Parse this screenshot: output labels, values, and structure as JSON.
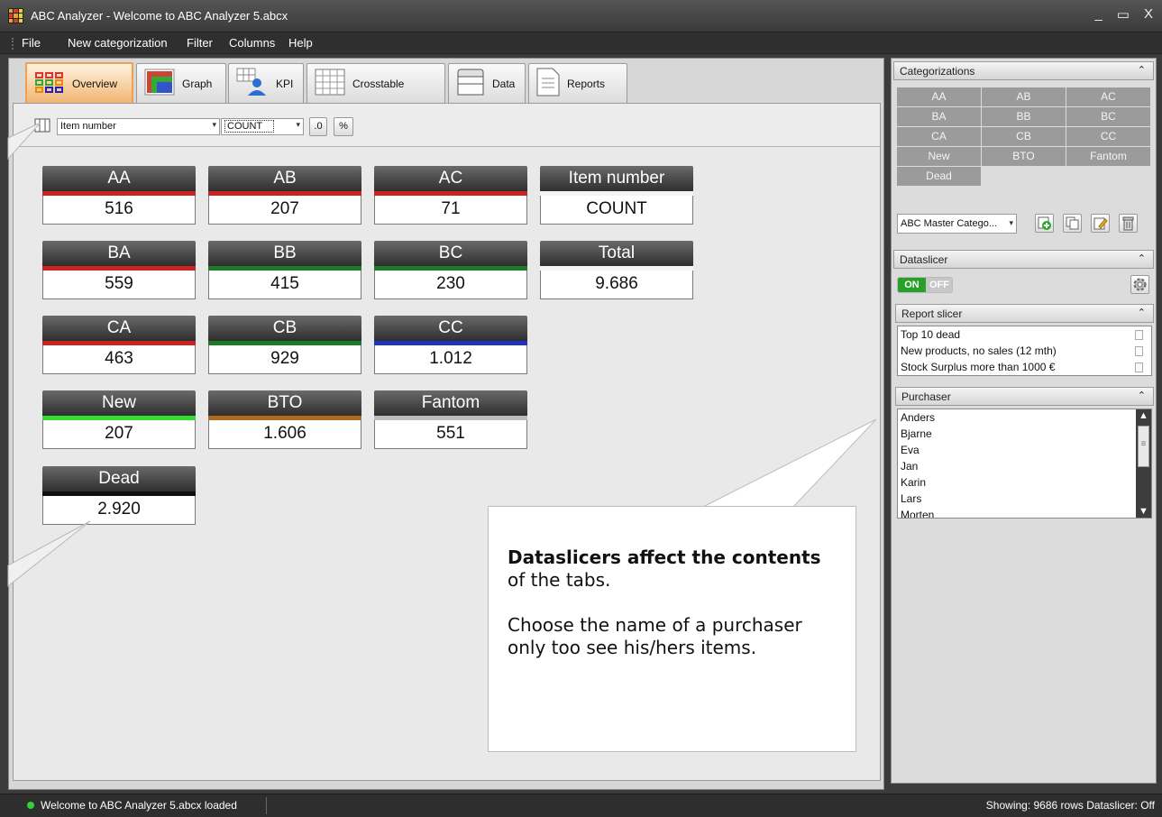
{
  "window": {
    "title": "ABC Analyzer - Welcome to ABC Analyzer 5.abcx"
  },
  "menu": [
    "File",
    "New categorization",
    "Filter",
    "Columns",
    "Help"
  ],
  "tabs": [
    {
      "label": "Overview",
      "icon": "overview-icon",
      "active": true
    },
    {
      "label": "Graph",
      "icon": "graph-icon"
    },
    {
      "label": "KPI",
      "icon": "kpi-icon"
    },
    {
      "label": "Crosstable",
      "icon": "crosstable-icon"
    },
    {
      "label": "Data",
      "icon": "data-icon"
    },
    {
      "label": "Reports",
      "icon": "reports-icon"
    }
  ],
  "toolbar": {
    "column_select": "Item number",
    "aggregate_select": "COUNT",
    "decimal_button": ".0",
    "percent_button": "%"
  },
  "tiles": [
    {
      "label": "AA",
      "value": "516",
      "color": "#cc2222"
    },
    {
      "label": "AB",
      "value": "207",
      "color": "#cc2222"
    },
    {
      "label": "AC",
      "value": "71",
      "color": "#cc2222"
    },
    {
      "label": "Item number",
      "value": "COUNT",
      "color": "#f4f4f4"
    },
    {
      "label": "BA",
      "value": "559",
      "color": "#cc2222"
    },
    {
      "label": "BB",
      "value": "415",
      "color": "#1a7a2a"
    },
    {
      "label": "BC",
      "value": "230",
      "color": "#1a7a2a"
    },
    {
      "label": "Total",
      "value": "9.686",
      "color": "#f4f4f4"
    },
    {
      "label": "CA",
      "value": "463",
      "color": "#cc2222"
    },
    {
      "label": "CB",
      "value": "929",
      "color": "#1a7a2a"
    },
    {
      "label": "CC",
      "value": "1.012",
      "color": "#2233bb"
    },
    {
      "label": "New",
      "value": "207",
      "color": "#33dd33"
    },
    {
      "label": "BTO",
      "value": "1.606",
      "color": "#b06a20"
    },
    {
      "label": "Fantom",
      "value": "551",
      "color": "#bbbbbb"
    },
    {
      "label": "Dead",
      "value": "2.920",
      "color": "#111111"
    }
  ],
  "tooltip": {
    "bold": "Dataslicers affect the contents",
    "rest": " of the tabs.",
    "para2": "Choose the name of a purchaser only too see his/hers items."
  },
  "side": {
    "categorizations": {
      "title": "Categorizations",
      "cells": [
        "AA",
        "AB",
        "AC",
        "BA",
        "BB",
        "BC",
        "CA",
        "CB",
        "CC",
        "New",
        "BTO",
        "Fantom",
        "Dead"
      ],
      "select": "ABC Master Catego..."
    },
    "dataslicer": {
      "title": "Dataslicer",
      "on": "ON",
      "off": "OFF"
    },
    "report_slicer": {
      "title": "Report slicer",
      "items": [
        "Top 10 dead",
        "New products, no sales (12 mth)",
        "Stock Surplus more than 1000 €"
      ]
    },
    "purchaser": {
      "title": "Purchaser",
      "items": [
        "Anders",
        "Bjarne",
        "Eva",
        "Jan",
        "Karin",
        "Lars",
        "Morten"
      ]
    }
  },
  "status": {
    "left": "Welcome to ABC Analyzer 5.abcx loaded",
    "right": "Showing: 9686 rows  Dataslicer: Off"
  }
}
